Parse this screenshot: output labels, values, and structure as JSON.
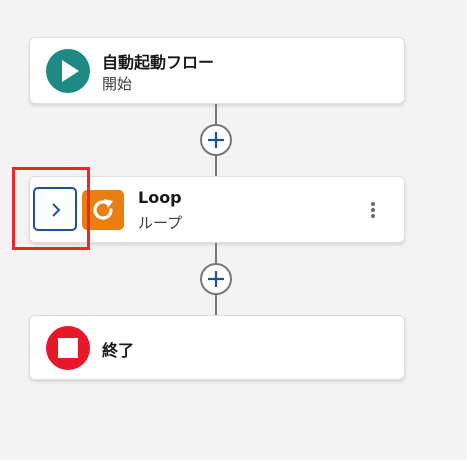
{
  "flow": {
    "start": {
      "title": "自動起動フロー",
      "subtitle": "開始",
      "icon": "play-icon",
      "color": "#1d8a84"
    },
    "loop": {
      "title": "Loop",
      "subtitle": "ループ",
      "icon": "loop-icon",
      "color": "#e97f12",
      "expand_icon": "chevron-right-icon",
      "menu_icon": "more-vertical-icon"
    },
    "end": {
      "title": "終了",
      "icon": "stop-icon",
      "color": "#e8182b"
    },
    "connectors": [
      {
        "icon": "plus-icon"
      },
      {
        "icon": "plus-icon"
      }
    ]
  },
  "colors": {
    "background": "#f3f3f3",
    "highlight": "#e8282b",
    "expand_border": "#1b5297",
    "plus": "#1b5297"
  }
}
